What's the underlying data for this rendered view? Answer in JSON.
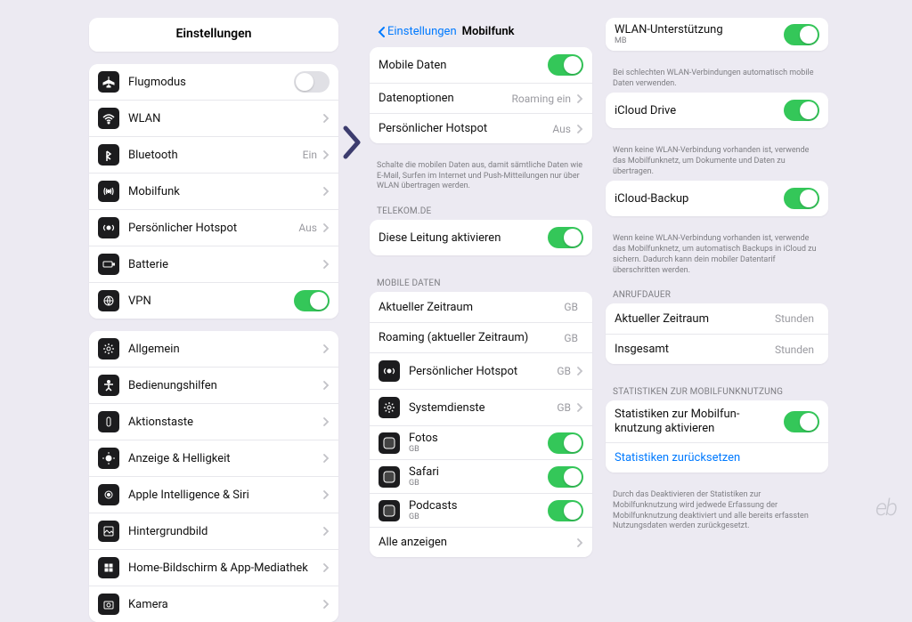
{
  "settings": {
    "title": "Einstellungen",
    "group1": [
      {
        "icon": "airplane",
        "label": "Flugmodus",
        "switch": false
      },
      {
        "icon": "wifi",
        "label": "WLAN",
        "chev": true
      },
      {
        "icon": "bluetooth",
        "label": "Bluetooth",
        "value": "Ein",
        "chev": true
      },
      {
        "icon": "antenna",
        "label": "Mobilfunk",
        "chev": true
      },
      {
        "icon": "hotspot",
        "label": "Persönlicher Hotspot",
        "value": "Aus",
        "chev": true
      },
      {
        "icon": "battery",
        "label": "Batterie",
        "chev": true
      },
      {
        "icon": "vpn",
        "label": "VPN",
        "switch": true
      }
    ],
    "group2": [
      {
        "icon": "gear",
        "label": "Allgemein",
        "chev": true
      },
      {
        "icon": "accessibility",
        "label": "Bedienungshilfen",
        "chev": true
      },
      {
        "icon": "action",
        "label": "Aktionstaste",
        "chev": true
      },
      {
        "icon": "brightness",
        "label": "Anzeige & Helligkeit",
        "chev": true
      },
      {
        "icon": "ai",
        "label": "Apple Intelligence & Siri",
        "chev": true
      },
      {
        "icon": "wallpaper",
        "label": "Hintergrundbild",
        "chev": true
      },
      {
        "icon": "home",
        "label": "Home-Bildschirm & App-Mediathek",
        "chev": true
      },
      {
        "icon": "camera",
        "label": "Kamera",
        "chev": true
      }
    ]
  },
  "cellular": {
    "back": "Einstellungen",
    "title": "Mobilfunk",
    "top": [
      {
        "label": "Mobile Daten",
        "switch": true
      },
      {
        "label": "Datenoptionen",
        "value": "Roaming ein",
        "chev": true
      },
      {
        "label": "Persönlicher Hotspot",
        "value": "Aus",
        "chev": true
      }
    ],
    "top_footer": "Schalte die mobilen Daten aus, damit sämtliche Daten wie E-Mail, Surfen im Internet und Push-Mitteilungen nur über WLAN übertragen werden.",
    "carrier_section": "TELEKOM.DE",
    "carrier_row": {
      "label": "Diese Leitung aktivieren",
      "switch": true
    },
    "data_section": "MOBILE DATEN",
    "data_rows": [
      {
        "label": "Aktueller Zeitraum",
        "value": "GB"
      },
      {
        "label": "Roaming (aktueller Zeitraum)",
        "value": "GB"
      },
      {
        "icon": "hotspot",
        "label": "Persönlicher Hotspot",
        "value": "GB",
        "chev": true
      },
      {
        "icon": "gear",
        "label": "Systemdienste",
        "value": "GB",
        "chev": true
      },
      {
        "icon": "app",
        "label": "Fotos",
        "sub": "GB",
        "switch": true
      },
      {
        "icon": "app",
        "label": "Safari",
        "sub": "GB",
        "switch": true
      },
      {
        "icon": "app",
        "label": "Podcasts",
        "sub": "GB",
        "switch": true
      }
    ],
    "show_all": "Alle anzeigen"
  },
  "right": {
    "wlan_assist": {
      "label": "WLAN-Unterstützung",
      "sub": "MB",
      "switch": true,
      "footer": "Bei schlechten WLAN-Verbindungen automatisch mobile Daten verwenden."
    },
    "icloud_drive": {
      "label": "iCloud Drive",
      "switch": true,
      "footer": "Wenn keine WLAN-Verbindung vorhanden ist, verwende das Mobilfunknetz, um Dokumente und Daten zu übertragen."
    },
    "icloud_backup": {
      "label": "iCloud-Backup",
      "switch": true,
      "footer": "Wenn keine WLAN-Verbindung vorhanden ist, verwende das Mobilfunknetz, um automatisch Backups in iCloud zu sichern. Dadurch kann dein mobiler Datentarif überschritten werden."
    },
    "call_section": "ANRUFDAUER",
    "call_rows": [
      {
        "label": "Aktueller Zeitraum",
        "value": "Stunden"
      },
      {
        "label": "Insgesamt",
        "value": "Stunden"
      }
    ],
    "stats_section": "STATISTIKEN ZUR MOBILFUNKNUTZUNG",
    "stats_row": {
      "label": "Statistiken zur Mobilfun-knutzung aktivieren",
      "switch": true
    },
    "stats_reset": "Statistiken zurücksetzen",
    "stats_footer": "Durch das Deaktivieren der Statistiken zur Mobilfunknutzung wird jedwede Erfassung der Mobilfunknutzung deaktiviert und alle bereits erfassten Nutzungsdaten werden zurückgesetzt."
  },
  "watermark": "eb"
}
